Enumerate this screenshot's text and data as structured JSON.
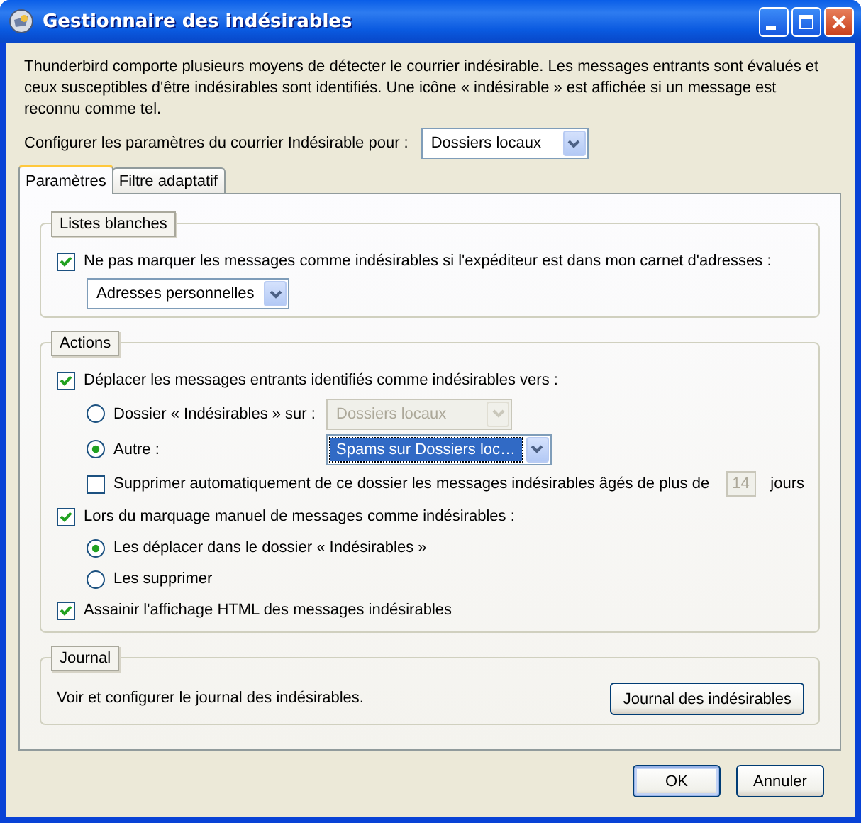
{
  "window": {
    "title": "Gestionnaire des indésirables"
  },
  "description": "Thunderbird comporte plusieurs moyens de détecter le courrier indésirable. Les messages entrants sont évalués et ceux susceptibles d'être indésirables sont identifiés. Une icône « indésirable » est affichée si un message est reconnu comme tel.",
  "account": {
    "label": "Configurer les paramètres du courrier Indésirable pour :",
    "value": "Dossiers locaux"
  },
  "tabs": [
    {
      "label": "Paramètres",
      "selected": true
    },
    {
      "label": "Filtre adaptatif",
      "selected": false
    }
  ],
  "groups": [
    {
      "title": "Listes blanches",
      "items": [
        {
          "kind": "checkbox",
          "label": "Ne pas marquer les messages comme indésirables si l'expéditeur est dans mon carnet d'adresses :",
          "checked": true,
          "children": [
            {
              "kind": "select",
              "value": "Adresses personnelles",
              "disabled": false,
              "focused": false
            }
          ]
        }
      ]
    },
    {
      "title": "Actions",
      "items": [
        {
          "kind": "checkbox",
          "label": "Déplacer les messages entrants identifiés comme indésirables vers :",
          "checked": true,
          "children": [
            {
              "kind": "radio",
              "label": "Dossier « Indésirables » sur :",
              "selected": false,
              "select": {
                "value": "Dossiers locaux",
                "disabled": true,
                "focused": false
              }
            },
            {
              "kind": "radio",
              "label": "Autre :",
              "selected": true,
              "select": {
                "value": "Spams sur Dossiers loc…",
                "disabled": false,
                "focused": true
              }
            },
            {
              "kind": "purge",
              "label": "Supprimer automatiquement de ce dossier les messages indésirables âgés de plus de",
              "checked": false,
              "days": "14",
              "days_disabled": true,
              "unit": "jours"
            }
          ]
        },
        {
          "kind": "checkbox",
          "label": "Lors du marquage manuel de messages comme indésirables :",
          "checked": true,
          "children": [
            {
              "kind": "radio",
              "label": "Les déplacer dans le dossier « Indésirables »",
              "selected": true
            },
            {
              "kind": "radio",
              "label": "Les supprimer",
              "selected": false
            }
          ]
        },
        {
          "kind": "checkbox",
          "label": "Assainir l'affichage HTML des messages indésirables",
          "checked": true
        }
      ]
    },
    {
      "title": "Journal",
      "items": [
        {
          "kind": "action",
          "text": "Voir et configurer le journal des indésirables.",
          "button": "Journal des indésirables"
        }
      ]
    }
  ],
  "buttons": [
    {
      "label": "OK",
      "default": true
    },
    {
      "label": "Annuler",
      "default": false
    }
  ]
}
